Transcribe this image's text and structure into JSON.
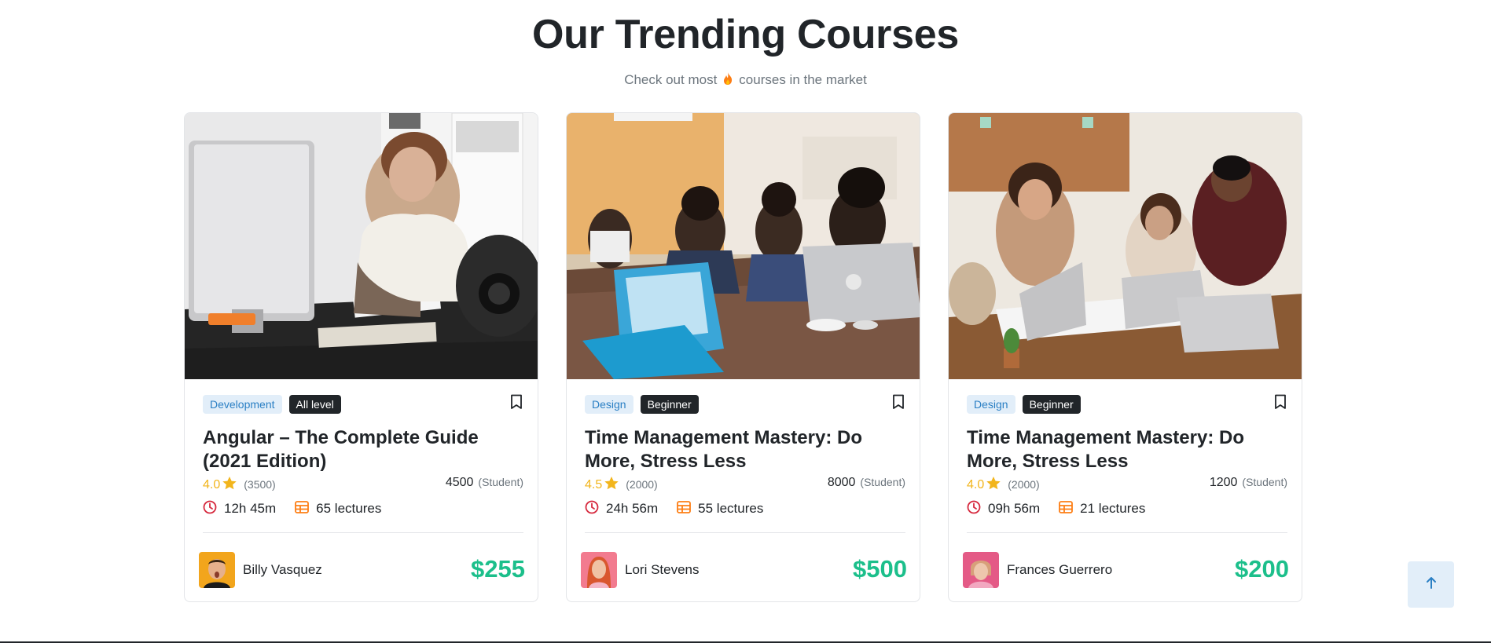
{
  "section": {
    "title": "Our Trending Courses",
    "subtitle_before": "Check out most",
    "subtitle_after": "courses in the market"
  },
  "courses": [
    {
      "category": "Development",
      "level": "All level",
      "title": "Angular – The Complete Guide (2021 Edition)",
      "rating": "4.0",
      "rating_count": "(3500)",
      "students": "4500",
      "students_label": "(Student)",
      "duration": "12h 45m",
      "lectures": "65 lectures",
      "author": "Billy Vasquez",
      "price": "$255"
    },
    {
      "category": "Design",
      "level": "Beginner",
      "title": "Time Management Mastery: Do More, Stress Less",
      "rating": "4.5",
      "rating_count": "(2000)",
      "students": "8000",
      "students_label": "(Student)",
      "duration": "24h 56m",
      "lectures": "55 lectures",
      "author": "Lori Stevens",
      "price": "$500"
    },
    {
      "category": "Design",
      "level": "Beginner",
      "title": "Time Management Mastery: Do More, Stress Less",
      "rating": "4.0",
      "rating_count": "(2000)",
      "students": "1200",
      "students_label": "(Student)",
      "duration": "09h 56m",
      "lectures": "21 lectures",
      "author": "Frances Guerrero",
      "price": "$200"
    }
  ],
  "icons": {
    "fire": "fire-icon",
    "star": "star-icon",
    "clock": "clock-icon",
    "lectures": "table-icon",
    "bookmark": "bookmark-icon",
    "scroll_top": "arrow-up-icon"
  },
  "colors": {
    "accent_blue": "#2a7fc4",
    "category_bg": "#e2eef9",
    "level_bg": "#212529",
    "rating": "#f2b51c",
    "price": "#1cbf8b",
    "clock": "#d6293e",
    "lectures": "#fd7e14"
  }
}
